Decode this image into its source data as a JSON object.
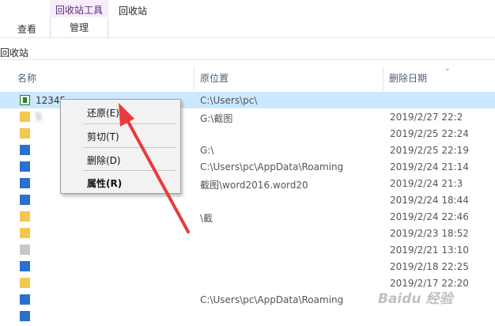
{
  "ribbon": {
    "context_group": "回收站工具",
    "window_title": "回收站",
    "tab_view": "查看",
    "tab_manage": "管理"
  },
  "address": {
    "path": "回收站"
  },
  "columns": {
    "name": "名称",
    "location": "原位置",
    "date_deleted": "删除日期"
  },
  "rows": [
    {
      "icon": "excel",
      "name": "12345",
      "location": "C:\\Users\\pc\\",
      "date": ""
    },
    {
      "icon": "folder",
      "name": "5",
      "location": "G:\\截图",
      "date": "2019/2/27 22:2"
    },
    {
      "icon": "folder",
      "name": "",
      "location": "",
      "date": "2019/2/25 22:24"
    },
    {
      "icon": "doc",
      "name": "",
      "location": "G:\\",
      "date": "2019/2/25 22:19"
    },
    {
      "icon": "doc",
      "name": "",
      "location": "C:\\Users\\pc\\AppData\\Roaming",
      "date": "2019/2/24 21:14"
    },
    {
      "icon": "doc",
      "name": "",
      "location": "截图\\word2016.word20",
      "date": "2019/2/24 21:3"
    },
    {
      "icon": "doc",
      "name": "",
      "location": "",
      "date": "2019/2/24 18:44"
    },
    {
      "icon": "folder",
      "name": "",
      "location": "\\截",
      "date": "2019/2/24 22:46"
    },
    {
      "icon": "folder",
      "name": "",
      "location": "",
      "date": "2019/2/23 18:52"
    },
    {
      "icon": "gray",
      "name": "",
      "location": "",
      "date": "2019/2/21 13:10"
    },
    {
      "icon": "doc",
      "name": "",
      "location": "",
      "date": "2019/2/18 22:25"
    },
    {
      "icon": "folder",
      "name": "",
      "location": "",
      "date": "2019/2/17 22:20"
    },
    {
      "icon": "doc",
      "name": "",
      "location": "C:\\Users\\pc\\AppData\\Roaming",
      "date": ""
    },
    {
      "icon": "doc",
      "name": "",
      "location": "",
      "date": ""
    }
  ],
  "context_menu": {
    "restore": "还原(E)",
    "cut": "剪切(T)",
    "delete": "删除(D)",
    "properties": "属性(R)"
  },
  "colors": {
    "selection": "#cce8ff",
    "context_tab": "#f7edfb",
    "annotation_arrow": "#e83b3b"
  },
  "watermark": "Baidu 经验"
}
